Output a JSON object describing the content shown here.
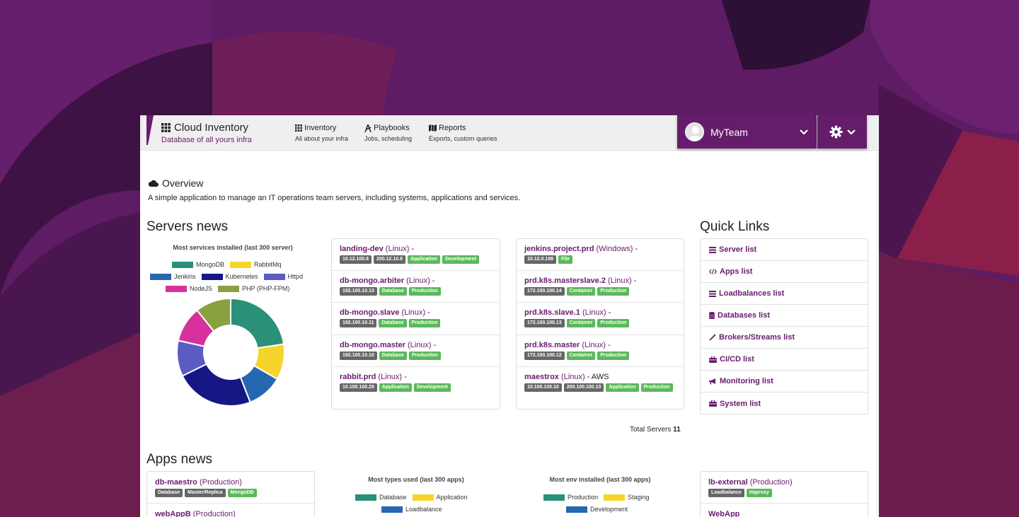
{
  "app": {
    "title": "Cloud Inventory",
    "subtitle": "Database of all yours infra",
    "accent": "#6a1b6e"
  },
  "nav": [
    {
      "icon": "grid-icon",
      "label": "Inventory",
      "sub": "All about your infra"
    },
    {
      "icon": "playbook-icon",
      "label": "Playbooks",
      "sub": "Jobs, scheduling"
    },
    {
      "icon": "map-icon",
      "label": "Reports",
      "sub": "Exports, custom queries"
    }
  ],
  "team": {
    "name": "MyTeam"
  },
  "overview": {
    "title": "Overview",
    "description": "A simple application to manage an IT operations team servers, including systems, applications and services."
  },
  "servers_news": {
    "heading": "Servers news",
    "chart_title": "Most services installed (last 300 server)",
    "total_label": "Total Servers",
    "total_value": "11",
    "col1": [
      {
        "name": "landing-dev",
        "os": "(Linux)",
        "suffix": " -",
        "tags": [
          {
            "t": "10.12.100.8",
            "c": "gray"
          },
          {
            "t": "200.12.10.8",
            "c": "gray"
          },
          {
            "t": "Application",
            "c": "green"
          },
          {
            "t": "Development",
            "c": "green"
          }
        ]
      },
      {
        "name": "db-mongo.arbiter",
        "os": "(Linux)",
        "suffix": " -",
        "tags": [
          {
            "t": "192.100.10.13",
            "c": "gray"
          },
          {
            "t": "Database",
            "c": "green"
          },
          {
            "t": "Production",
            "c": "green"
          }
        ]
      },
      {
        "name": "db-mongo.slave",
        "os": "(Linux)",
        "suffix": " -",
        "tags": [
          {
            "t": "192.100.10.11",
            "c": "gray"
          },
          {
            "t": "Database",
            "c": "green"
          },
          {
            "t": "Production",
            "c": "green"
          }
        ]
      },
      {
        "name": "db-mongo.master",
        "os": "(Linux)",
        "suffix": " -",
        "tags": [
          {
            "t": "192.100.10.10",
            "c": "gray"
          },
          {
            "t": "Database",
            "c": "green"
          },
          {
            "t": "Production",
            "c": "green"
          }
        ]
      },
      {
        "name": "rabbit.prd",
        "os": "(Linux)",
        "suffix": " -",
        "tags": [
          {
            "t": "10.100.100.29",
            "c": "gray"
          },
          {
            "t": "Application",
            "c": "green"
          },
          {
            "t": "Development",
            "c": "green"
          }
        ]
      }
    ],
    "col2": [
      {
        "name": "jenkins.project.prd",
        "os": "(Windows)",
        "suffix": " -",
        "tags": [
          {
            "t": "10.12.0.198",
            "c": "gray"
          },
          {
            "t": "File",
            "c": "green"
          }
        ]
      },
      {
        "name": "prd.k8s.masterslave.2",
        "os": "(Linux)",
        "suffix": " -",
        "tags": [
          {
            "t": "172.100.100.14",
            "c": "gray"
          },
          {
            "t": "Container",
            "c": "green"
          },
          {
            "t": "Production",
            "c": "green"
          }
        ]
      },
      {
        "name": "prd.k8s.slave.1",
        "os": "(Linux)",
        "suffix": " -",
        "tags": [
          {
            "t": "172.100.100.13",
            "c": "gray"
          },
          {
            "t": "Container",
            "c": "green"
          },
          {
            "t": "Production",
            "c": "green"
          }
        ]
      },
      {
        "name": "prd.k8s.master",
        "os": "(Linux)",
        "suffix": " -",
        "tags": [
          {
            "t": "172.100.100.12",
            "c": "gray"
          },
          {
            "t": "Container",
            "c": "green"
          },
          {
            "t": "Production",
            "c": "green"
          }
        ]
      },
      {
        "name": "maestrox",
        "os": "(Linux)",
        "suffix": " - AWS",
        "tags": [
          {
            "t": "10.100.100.10",
            "c": "gray"
          },
          {
            "t": "200.100.100.10",
            "c": "gray"
          },
          {
            "t": "Application",
            "c": "green"
          },
          {
            "t": "Production",
            "c": "green"
          }
        ]
      }
    ]
  },
  "quick_links": {
    "heading": "Quick Links",
    "items": [
      {
        "icon": "list-icon",
        "label": "Server list"
      },
      {
        "icon": "code-icon",
        "label": "Apps list"
      },
      {
        "icon": "list-icon",
        "label": "Loadbalances list"
      },
      {
        "icon": "database-icon",
        "label": "Databases list"
      },
      {
        "icon": "wand-icon",
        "label": "Brokers/Streams list"
      },
      {
        "icon": "briefcase-icon",
        "label": "CI/CD list"
      },
      {
        "icon": "bullhorn-icon",
        "label": "Monitoring list"
      },
      {
        "icon": "briefcase-icon",
        "label": "System list"
      }
    ]
  },
  "apps_news": {
    "heading": "Apps news",
    "left": [
      {
        "name": "db-maestro",
        "env": "(Production)",
        "tags": [
          {
            "t": "Database",
            "c": "gray"
          },
          {
            "t": "Master/Replica",
            "c": "gray"
          },
          {
            "t": "MongoDB",
            "c": "green"
          }
        ]
      },
      {
        "name": "webAppB",
        "env": "(Production)",
        "tags": []
      }
    ],
    "right": [
      {
        "name": "lb-external",
        "env": "(Production)",
        "tags": [
          {
            "t": "Loadbalance",
            "c": "gray"
          },
          {
            "t": "Haproxy",
            "c": "green"
          }
        ]
      },
      {
        "name": "WebApp",
        "env": "",
        "tags": []
      }
    ],
    "types_chart_title": "Most types used (last 300 apps)",
    "types_legend": [
      {
        "name": "Database",
        "color": "#2a9078"
      },
      {
        "name": "Application",
        "color": "#f6d52a"
      },
      {
        "name": "Loadbalance",
        "color": "#2667b1"
      }
    ],
    "env_chart_title": "Most env installed (last 300 apps)",
    "env_legend": [
      {
        "name": "Production",
        "color": "#2a9078"
      },
      {
        "name": "Staging",
        "color": "#f6d52a"
      },
      {
        "name": "Development",
        "color": "#2667b1"
      }
    ]
  },
  "chart_data": {
    "type": "pie",
    "title": "Most services installed (last 300 server)",
    "categories": [
      "MongoDB",
      "RabbitMq",
      "Jenkins",
      "Kubernetes",
      "Httpd",
      "NodeJS",
      "PHP (PHP-FPM)"
    ],
    "values": [
      21,
      10,
      10,
      22,
      10,
      10,
      10
    ],
    "colors": [
      "#2a9078",
      "#f6d52a",
      "#2667b1",
      "#171685",
      "#5b5bc4",
      "#d6319c",
      "#8aa142"
    ],
    "legend": "top",
    "donut": true
  }
}
